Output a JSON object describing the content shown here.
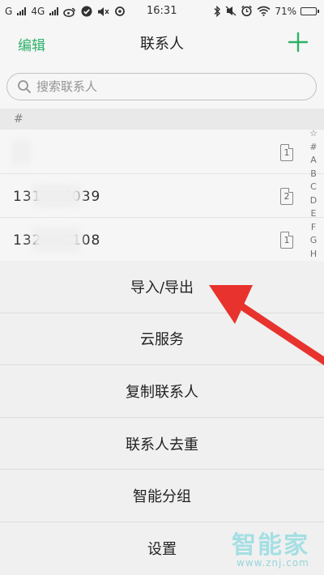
{
  "status_bar": {
    "carrier_left": "G",
    "network_label": "4G",
    "time": "16:31",
    "battery_percent": "71%",
    "battery_level": 0.71,
    "icons": [
      "signal-icon",
      "weibo-icon",
      "check-icon",
      "mute-icon",
      "sync-icon",
      "bluetooth-icon",
      "dnd-icon",
      "alarm-icon",
      "wifi-icon",
      "battery-icon"
    ]
  },
  "header": {
    "edit_label": "编辑",
    "title": "联系人",
    "add_icon": "plus-icon",
    "accent_color": "#2eb86b"
  },
  "search": {
    "placeholder": "搜索联系人",
    "value": ""
  },
  "section_label": "#",
  "contacts": [
    {
      "name": "",
      "sim": "1"
    },
    {
      "name": "131····6039",
      "sim": "2"
    },
    {
      "name": "132····8108",
      "sim": "1"
    }
  ],
  "alpha_index": [
    "☆",
    "#",
    "A",
    "B",
    "C",
    "D",
    "E",
    "F",
    "G",
    "H"
  ],
  "menu": [
    {
      "label": "导入/导出"
    },
    {
      "label": "云服务"
    },
    {
      "label": "复制联系人"
    },
    {
      "label": "联系人去重"
    },
    {
      "label": "智能分组"
    },
    {
      "label": "设置"
    }
  ],
  "annotation": {
    "color": "#e8322d"
  },
  "watermark": {
    "name": "智能家",
    "url": "www.znj.com"
  }
}
